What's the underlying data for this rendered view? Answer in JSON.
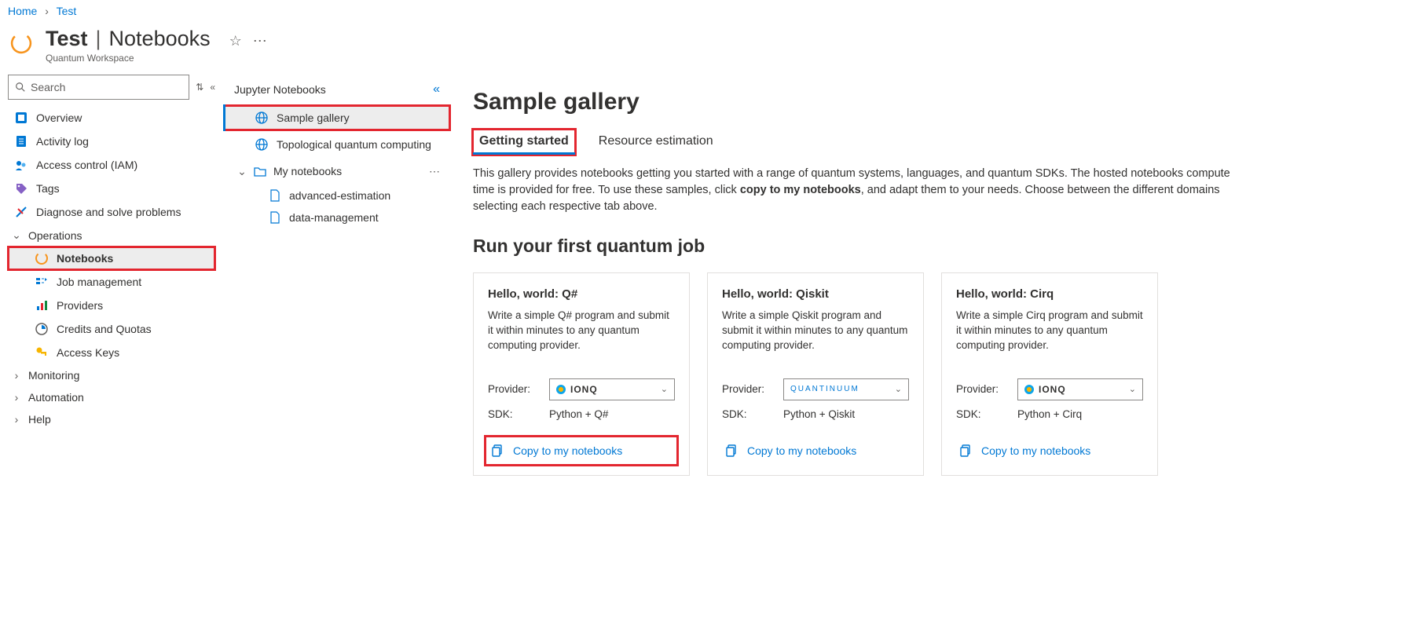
{
  "breadcrumb": {
    "home": "Home",
    "current": "Test"
  },
  "header": {
    "resource_name": "Test",
    "section": "Notebooks",
    "type": "Quantum Workspace",
    "search_placeholder": "Search"
  },
  "nav": {
    "overview": "Overview",
    "activity": "Activity log",
    "access": "Access control (IAM)",
    "tags": "Tags",
    "diagnose": "Diagnose and solve problems",
    "group_operations": "Operations",
    "notebooks": "Notebooks",
    "jobs": "Job management",
    "providers": "Providers",
    "credits": "Credits and Quotas",
    "keys": "Access Keys",
    "group_monitoring": "Monitoring",
    "group_automation": "Automation",
    "group_help": "Help"
  },
  "tree": {
    "header": "Jupyter Notebooks",
    "sample_gallery": "Sample gallery",
    "topological": "Topological quantum computing",
    "my_notebooks": "My notebooks",
    "file1": "advanced-estimation",
    "file2": "data-management"
  },
  "main": {
    "title": "Sample gallery",
    "tab_started": "Getting started",
    "tab_resource": "Resource estimation",
    "desc_pre": "This gallery provides notebooks getting you started with a range of quantum systems, languages, and quantum SDKs. The hosted notebooks compute time is provided for free. To use these samples, click ",
    "desc_bold": "copy to my notebooks",
    "desc_post": ", and adapt them to your needs. Choose between the different domains selecting each respective tab above.",
    "section": "Run your first quantum job",
    "provider_label": "Provider:",
    "sdk_label": "SDK:",
    "copy_label": "Copy to my notebooks",
    "cards": [
      {
        "title": "Hello, world: Q#",
        "desc": "Write a simple Q# program and submit it within minutes to any quantum computing provider.",
        "provider": "IONQ",
        "sdk": "Python + Q#"
      },
      {
        "title": "Hello, world: Qiskit",
        "desc": "Write a simple Qiskit program and submit it within minutes to any quantum computing provider.",
        "provider": "QUANTINUUM",
        "sdk": "Python + Qiskit"
      },
      {
        "title": "Hello, world: Cirq",
        "desc": "Write a simple Cirq program and submit it within minutes to any quantum computing provider.",
        "provider": "IONQ",
        "sdk": "Python + Cirq"
      }
    ]
  }
}
